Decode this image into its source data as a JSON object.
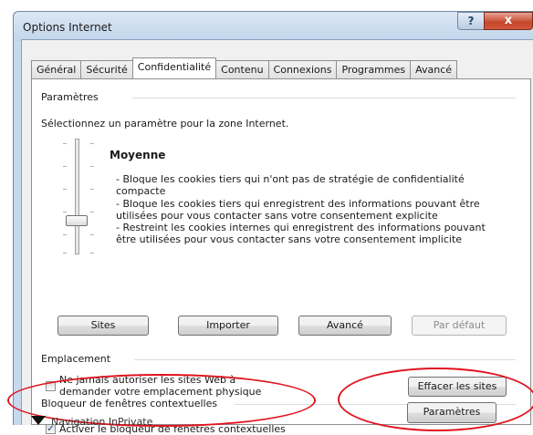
{
  "window": {
    "title": "Options Internet",
    "help_glyph": "?",
    "close_glyph": "x"
  },
  "tabs": [
    {
      "label": "Général"
    },
    {
      "label": "Sécurité"
    },
    {
      "label": "Confidentialité",
      "active": true
    },
    {
      "label": "Contenu"
    },
    {
      "label": "Connexions"
    },
    {
      "label": "Programmes"
    },
    {
      "label": "Avancé"
    }
  ],
  "settings": {
    "group_label": "Paramètres",
    "instruction": "Sélectionnez un paramètre pour la zone Internet.",
    "level_title": "Moyenne",
    "level_lines": [
      "- Bloque les cookies tiers qui n'ont pas de stratégie de confidentialité",
      "compacte",
      "- Bloque les cookies tiers qui enregistrent des informations pouvant être",
      "utilisées pour vous contacter sans votre consentement explicite",
      "- Restreint les cookies internes qui enregistrent des informations pouvant",
      "être utilisées pour vous contacter sans votre consentement implicite"
    ],
    "buttons": {
      "sites": "Sites",
      "import": "Importer",
      "advanced": "Avancé",
      "default": "Par défaut"
    }
  },
  "location": {
    "group_label": "Emplacement",
    "checkbox_line1": "Ne jamais autoriser les sites Web à",
    "checkbox_line2": "demander votre emplacement physique",
    "clear_button": "Effacer les sites"
  },
  "popup": {
    "group_label": "Bloqueur de fenêtres contextuelles",
    "checkbox_label": "Activer le bloqueur de fenêtres contextuelles",
    "checked_glyph": "✓",
    "settings_button": "Paramètres"
  },
  "background": {
    "fragment_bottom": "Navigation InPrivate"
  },
  "annotation_color": "#e0141e"
}
